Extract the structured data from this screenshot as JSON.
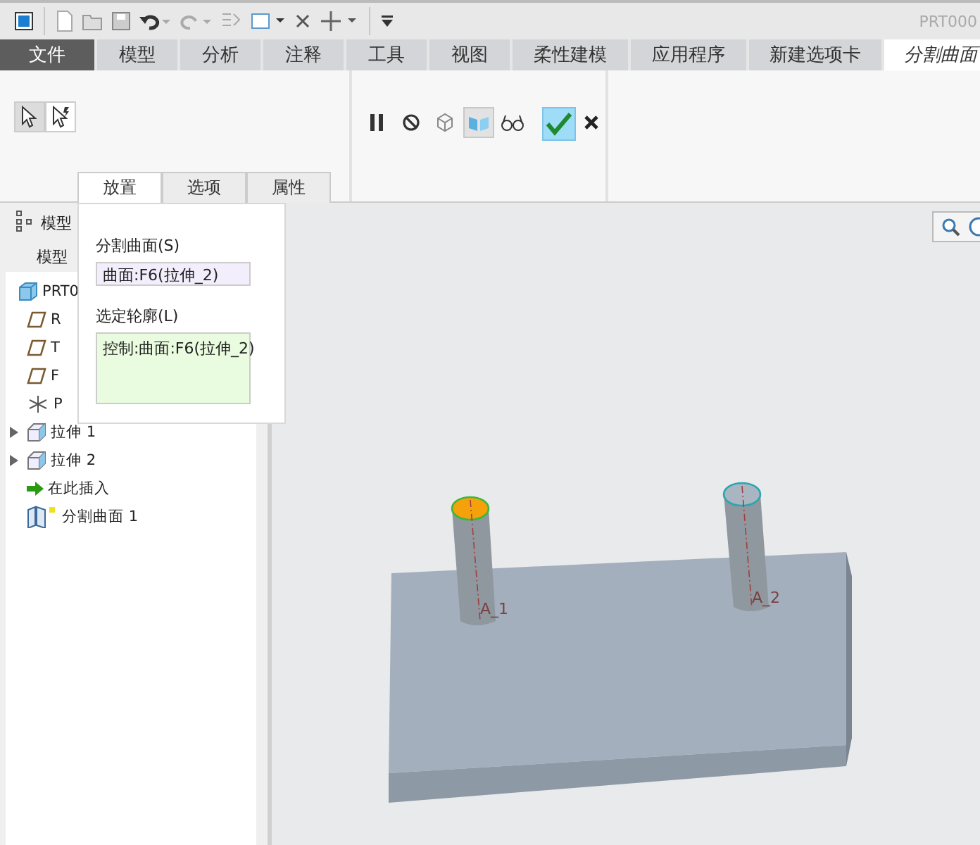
{
  "window": {
    "title": "PRT000"
  },
  "ribbon_tabs": [
    {
      "label": "文件",
      "kind": "file",
      "selected": false
    },
    {
      "label": "模型",
      "kind": "tab",
      "selected": false
    },
    {
      "label": "分析",
      "kind": "tab",
      "selected": false
    },
    {
      "label": "注释",
      "kind": "tab",
      "selected": false
    },
    {
      "label": "工具",
      "kind": "tab",
      "selected": false
    },
    {
      "label": "视图",
      "kind": "tab",
      "selected": false
    },
    {
      "label": "柔性建模",
      "kind": "tab",
      "selected": false
    },
    {
      "label": "应用程序",
      "kind": "tab",
      "selected": false
    },
    {
      "label": "新建选项卡",
      "kind": "tab",
      "selected": false
    },
    {
      "label": "分割曲面",
      "kind": "tab",
      "selected": true
    }
  ],
  "select_buttons": [
    {
      "selected": true
    },
    {
      "selected": false
    }
  ],
  "dashboard_tools": [
    {
      "selected": false
    },
    {
      "selected": false
    },
    {
      "selected": false
    },
    {
      "selected": true
    },
    {
      "selected": false
    }
  ],
  "dashboard_tabs": [
    {
      "label": "放置",
      "selected": true
    },
    {
      "label": "选项",
      "selected": false
    },
    {
      "label": "属性",
      "selected": false
    }
  ],
  "placement_panel": {
    "surface_label": "分割曲面(S)",
    "surface_value": "曲面:F6(拉伸_2)",
    "outline_label": "选定轮廓(L)",
    "outline_value": "控制:曲面:F6(拉伸_2)"
  },
  "model_tree": {
    "header": "模型",
    "column": "模型",
    "items": [
      {
        "label": "PRT0",
        "kind": "part"
      },
      {
        "label": "R",
        "kind": "plane"
      },
      {
        "label": "T",
        "kind": "plane"
      },
      {
        "label": "F",
        "kind": "plane"
      },
      {
        "label": "P",
        "kind": "csys"
      },
      {
        "label": "拉伸 1",
        "kind": "extrude",
        "expanded": false
      },
      {
        "label": "拉伸 2",
        "kind": "extrude",
        "expanded": false
      },
      {
        "label": "在此插入",
        "kind": "insert"
      },
      {
        "label": "分割曲面 1",
        "kind": "split"
      }
    ]
  },
  "graphics": {
    "axis_labels": [
      "A_1",
      "A_2"
    ]
  }
}
